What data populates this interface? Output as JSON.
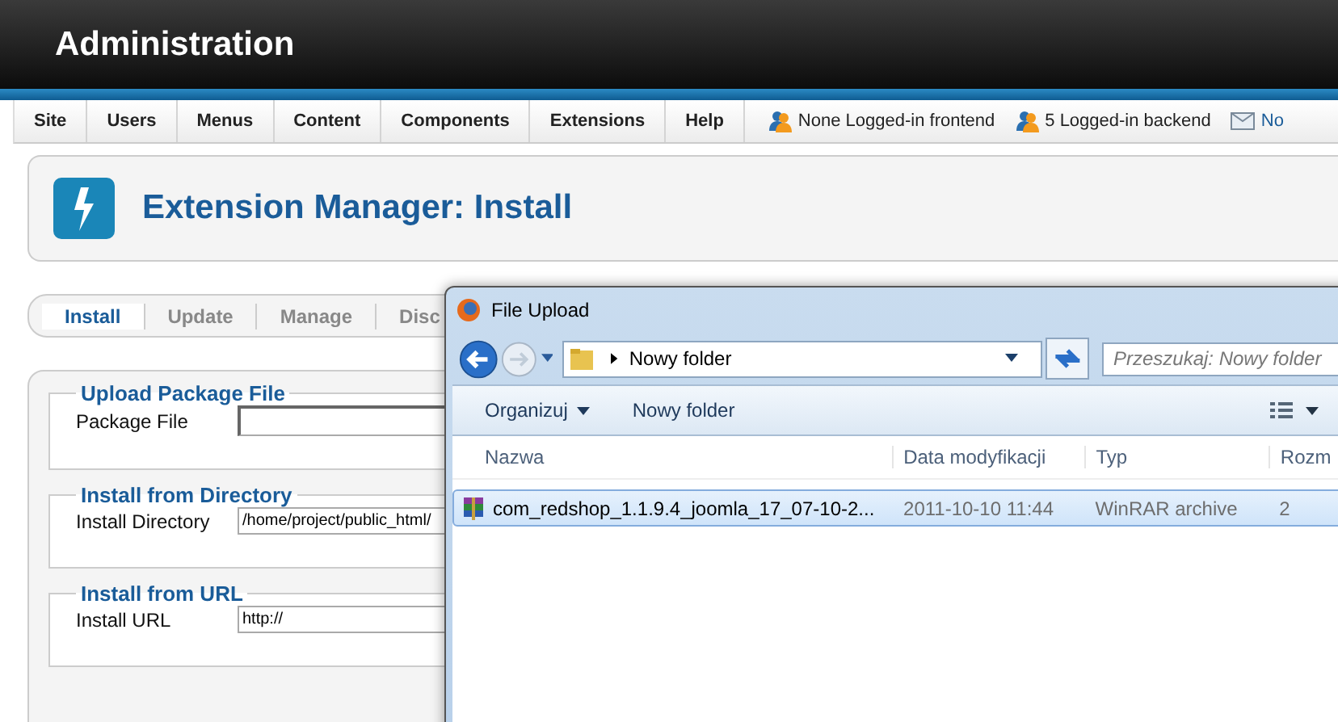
{
  "header": {
    "title": "Administration"
  },
  "menu": {
    "items": [
      "Site",
      "Users",
      "Menus",
      "Content",
      "Components",
      "Extensions",
      "Help"
    ],
    "status": [
      {
        "kind": "users",
        "text": "None Logged-in frontend"
      },
      {
        "kind": "users",
        "text": "5 Logged-in backend"
      },
      {
        "kind": "message",
        "text": "No"
      }
    ]
  },
  "page_title": "Extension Manager: Install",
  "tabs": [
    {
      "label": "Install",
      "selected": true
    },
    {
      "label": "Update",
      "selected": false
    },
    {
      "label": "Manage",
      "selected": false
    },
    {
      "label": "Disc",
      "selected": false
    }
  ],
  "sections": [
    {
      "legend": "Upload Package File",
      "label": "Package File",
      "kind": "file"
    },
    {
      "legend": "Install from Directory",
      "label": "Install Directory",
      "kind": "text",
      "value": "/home/project/public_html/"
    },
    {
      "legend": "Install from URL",
      "label": "Install URL",
      "kind": "text",
      "value": "http://"
    }
  ],
  "dialog": {
    "title": "File Upload",
    "path": "Nowy folder",
    "search_placeholder": "Przeszukaj: Nowy folder",
    "toolbar": [
      {
        "label": "Organizuj",
        "kind": "dropdown"
      },
      {
        "label": "Nowy folder",
        "kind": "plain"
      }
    ],
    "columns": [
      "Nazwa",
      "Data modyfikacji",
      "Typ",
      "Rozm"
    ],
    "files": [
      {
        "name": "com_redshop_1.1.9.4_joomla_17_07-10-2...",
        "date": "2011-10-10 11:44",
        "type": "WinRAR archive",
        "size": "2",
        "selected": true
      }
    ]
  }
}
